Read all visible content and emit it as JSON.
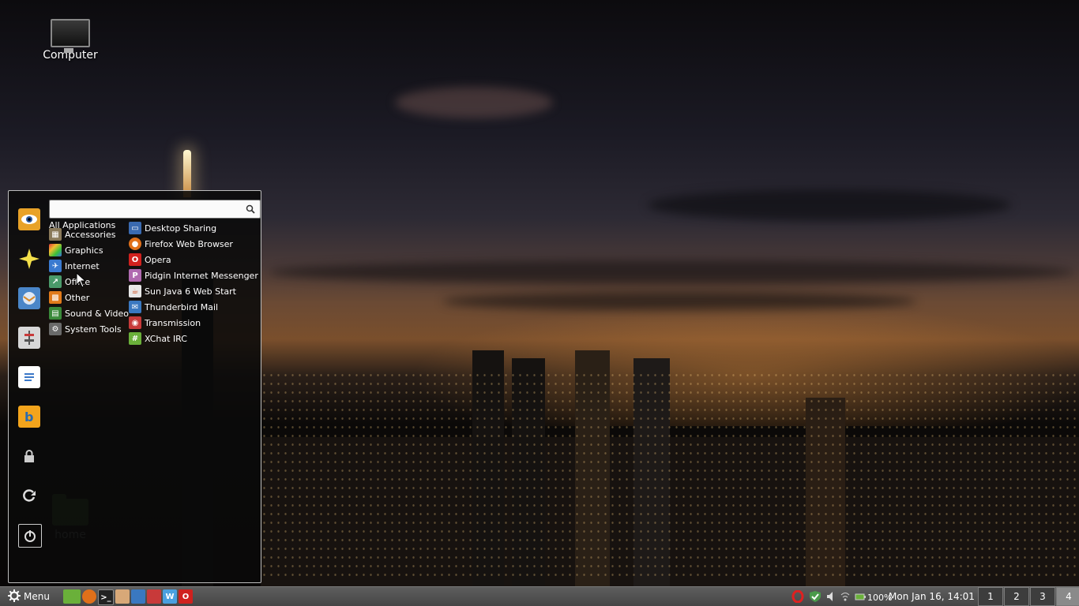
{
  "desktop": {
    "icons": [
      {
        "label": "Computer",
        "icon": "computer-icon"
      },
      {
        "label": "home",
        "icon": "folder-home-icon"
      }
    ]
  },
  "menu": {
    "favorites": [
      {
        "name": "eye-of-gnome-icon",
        "color": "#e8a228"
      },
      {
        "name": "star-icon",
        "color": "#f4e04a"
      },
      {
        "name": "thunderbird-icon",
        "color": "#4a86c8"
      },
      {
        "name": "settings-panel-icon",
        "color": "#d0d0d0"
      },
      {
        "name": "writer-document-icon",
        "color": "#3b78c8"
      },
      {
        "name": "bookmark-b-icon",
        "color": "#f3a41c"
      },
      {
        "name": "lock-icon",
        "color": "#cccccc"
      },
      {
        "name": "logout-icon",
        "color": "#cccccc"
      },
      {
        "name": "power-icon",
        "color": "#cccccc"
      }
    ],
    "search": {
      "value": "",
      "placeholder": ""
    },
    "all_applications_label": "All Applications",
    "categories": [
      {
        "label": "Accessories",
        "icon": "accessories-icon",
        "color": "#8a7a5a"
      },
      {
        "label": "Graphics",
        "icon": "graphics-icon",
        "color": "#d03a3a"
      },
      {
        "label": "Internet",
        "icon": "internet-icon",
        "color": "#3a7ad0"
      },
      {
        "label": "Office",
        "icon": "office-icon",
        "color": "#4a9a6a"
      },
      {
        "label": "Other",
        "icon": "other-icon",
        "color": "#e07a1a"
      },
      {
        "label": "Sound & Video",
        "icon": "sound-video-icon",
        "color": "#3a8a3a"
      },
      {
        "label": "System Tools",
        "icon": "system-tools-icon",
        "color": "#6a6a6a"
      }
    ],
    "apps": [
      {
        "label": "Desktop Sharing",
        "icon": "desktop-sharing-icon",
        "color": "#3a6ab0"
      },
      {
        "label": "Firefox Web Browser",
        "icon": "firefox-icon",
        "color": "#e0701a"
      },
      {
        "label": "Opera",
        "icon": "opera-icon",
        "color": "#d0211e"
      },
      {
        "label": "Pidgin Internet Messenger",
        "icon": "pidgin-icon",
        "color": "#b06ab0"
      },
      {
        "label": "Sun Java 6 Web Start",
        "icon": "java-icon",
        "color": "#e8e8e8"
      },
      {
        "label": "Thunderbird Mail",
        "icon": "thunderbird-icon",
        "color": "#3a78c0"
      },
      {
        "label": "Transmission",
        "icon": "transmission-icon",
        "color": "#c83a3a"
      },
      {
        "label": "XChat IRC",
        "icon": "xchat-icon",
        "color": "#6ab03a"
      }
    ]
  },
  "taskbar": {
    "menu_label": "Menu",
    "quicklaunch": [
      {
        "name": "show-desktop-icon",
        "color": "#6ab03a"
      },
      {
        "name": "firefox-icon",
        "color": "#e0701a"
      },
      {
        "name": "terminal-icon",
        "color": "#222222"
      },
      {
        "name": "file-manager-icon",
        "color": "#d8a878"
      },
      {
        "name": "thunderbird-icon",
        "color": "#3a78c0"
      },
      {
        "name": "transmission-icon",
        "color": "#c83a3a"
      },
      {
        "name": "writer-icon",
        "color": "#4aa0e0"
      },
      {
        "name": "opera-icon",
        "color": "#d0211e"
      }
    ],
    "battery": "100%",
    "clock": "Mon Jan 16, 14:01",
    "workspaces": [
      "1",
      "2",
      "3",
      "4"
    ],
    "active_workspace": "4"
  }
}
